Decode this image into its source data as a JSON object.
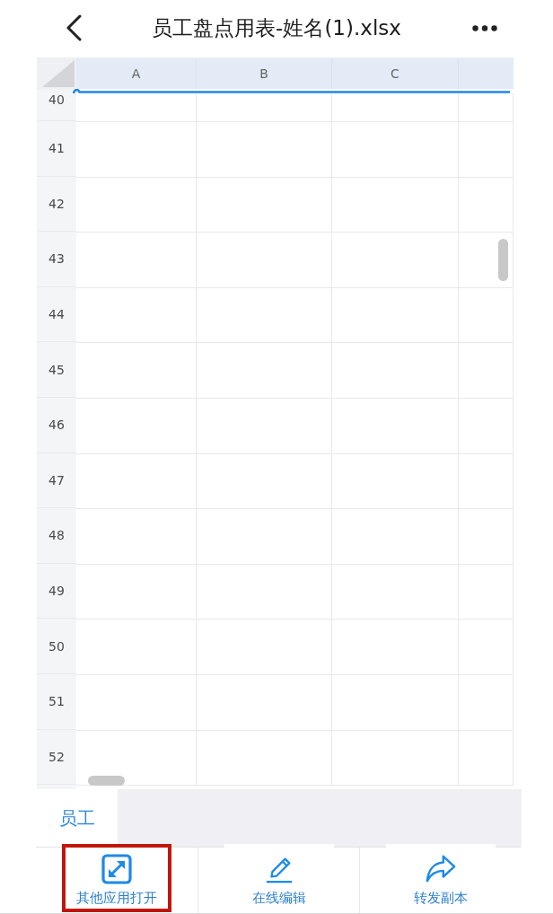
{
  "header": {
    "title": "员工盘点用表-姓名(1).xlsx"
  },
  "sheet": {
    "columns": [
      "A",
      "B",
      "C"
    ],
    "rows": [
      "40",
      "41",
      "42",
      "43",
      "44",
      "45",
      "46",
      "47",
      "48",
      "49",
      "50",
      "51",
      "52"
    ]
  },
  "sheet_tabs": [
    {
      "label": "员工",
      "selected": true
    }
  ],
  "toolbar": [
    {
      "kind": "open-with",
      "label": "其他应用打开",
      "highlighted": true
    },
    {
      "kind": "edit",
      "label": "在线编辑",
      "highlighted": false
    },
    {
      "kind": "share",
      "label": "转发副本",
      "highlighted": false
    }
  ]
}
